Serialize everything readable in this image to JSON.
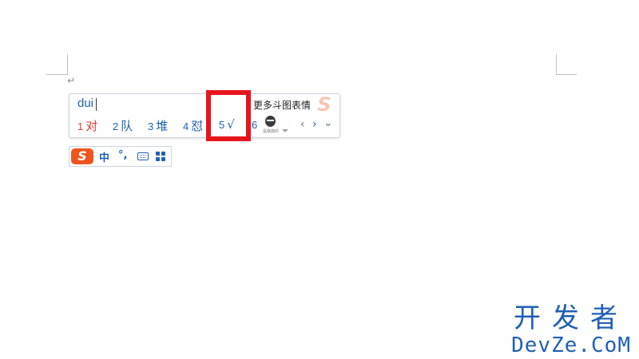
{
  "document": {
    "paragraph_mark": "↵"
  },
  "ime": {
    "pinyin": "dui",
    "more_stickers": "更多斗图表情",
    "logo_watermark": "S",
    "candidates": [
      {
        "num": "1",
        "text": "对"
      },
      {
        "num": "2",
        "text": "队"
      },
      {
        "num": "3",
        "text": "堆"
      },
      {
        "num": "4",
        "text": "怼"
      },
      {
        "num": "5",
        "text": "√"
      },
      {
        "num": "6",
        "text": ""
      }
    ],
    "sticker_caption": "是我搞的",
    "nav_prev": "‹",
    "nav_next": "›",
    "nav_expand": "⌄",
    "highlight_color": "#e8141c",
    "active_color": "#e53935",
    "accent_color": "#1f5fb5"
  },
  "statusbar": {
    "logo": "S",
    "mode": "中",
    "punct": "°,",
    "keyboard_icon": "keyboard-icon",
    "toolbox_icon": "grid-icon"
  },
  "brand": {
    "cn": "开发者",
    "en": "DevZe.CoM"
  }
}
